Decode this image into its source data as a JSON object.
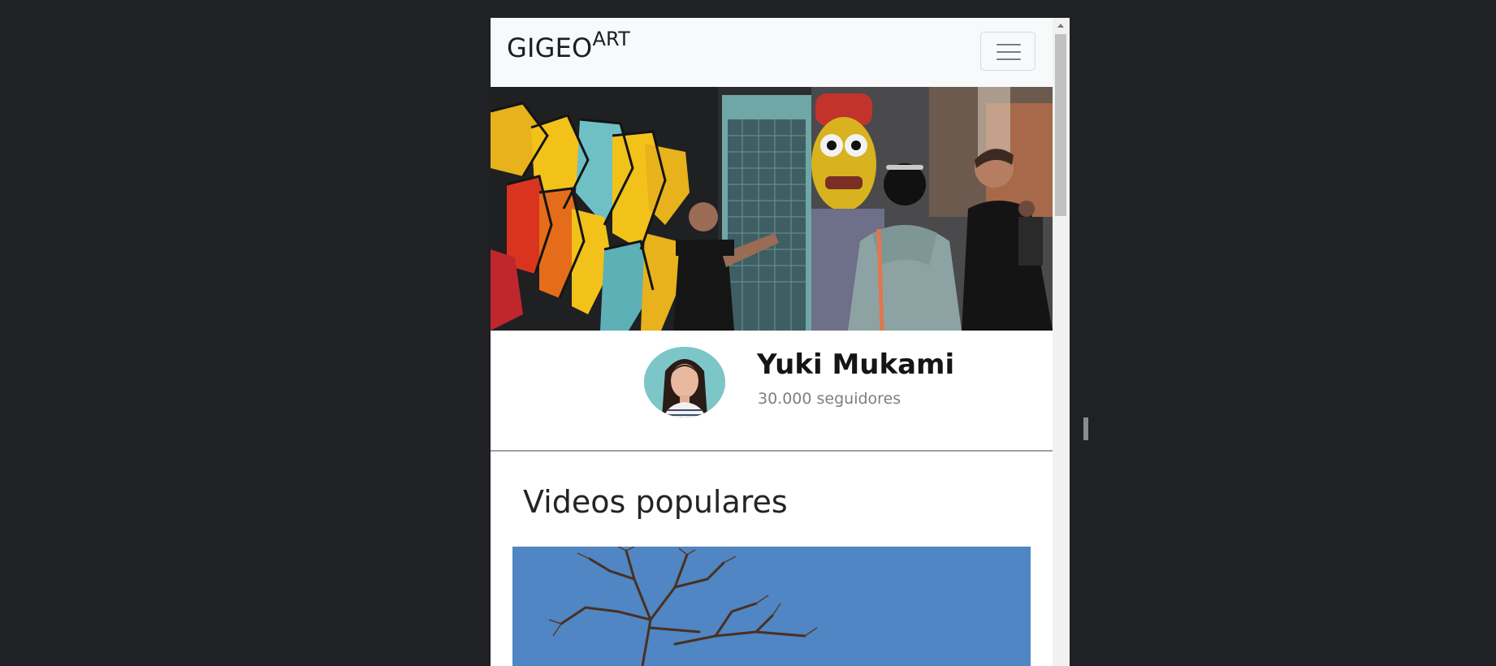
{
  "navbar": {
    "brand_main": "GIGEO",
    "brand_sup": "ART",
    "toggler_icon": "hamburger-menu-icon"
  },
  "profile": {
    "name": "Yuki Mukami",
    "followers": "30.000 seguidores"
  },
  "videos": {
    "section_title": "Videos populares"
  },
  "colors": {
    "navbar_bg": "#f8f9fa",
    "page_bg": "#ffffff",
    "outer_bg": "#202124",
    "sky_blue": "#4e86c2"
  }
}
